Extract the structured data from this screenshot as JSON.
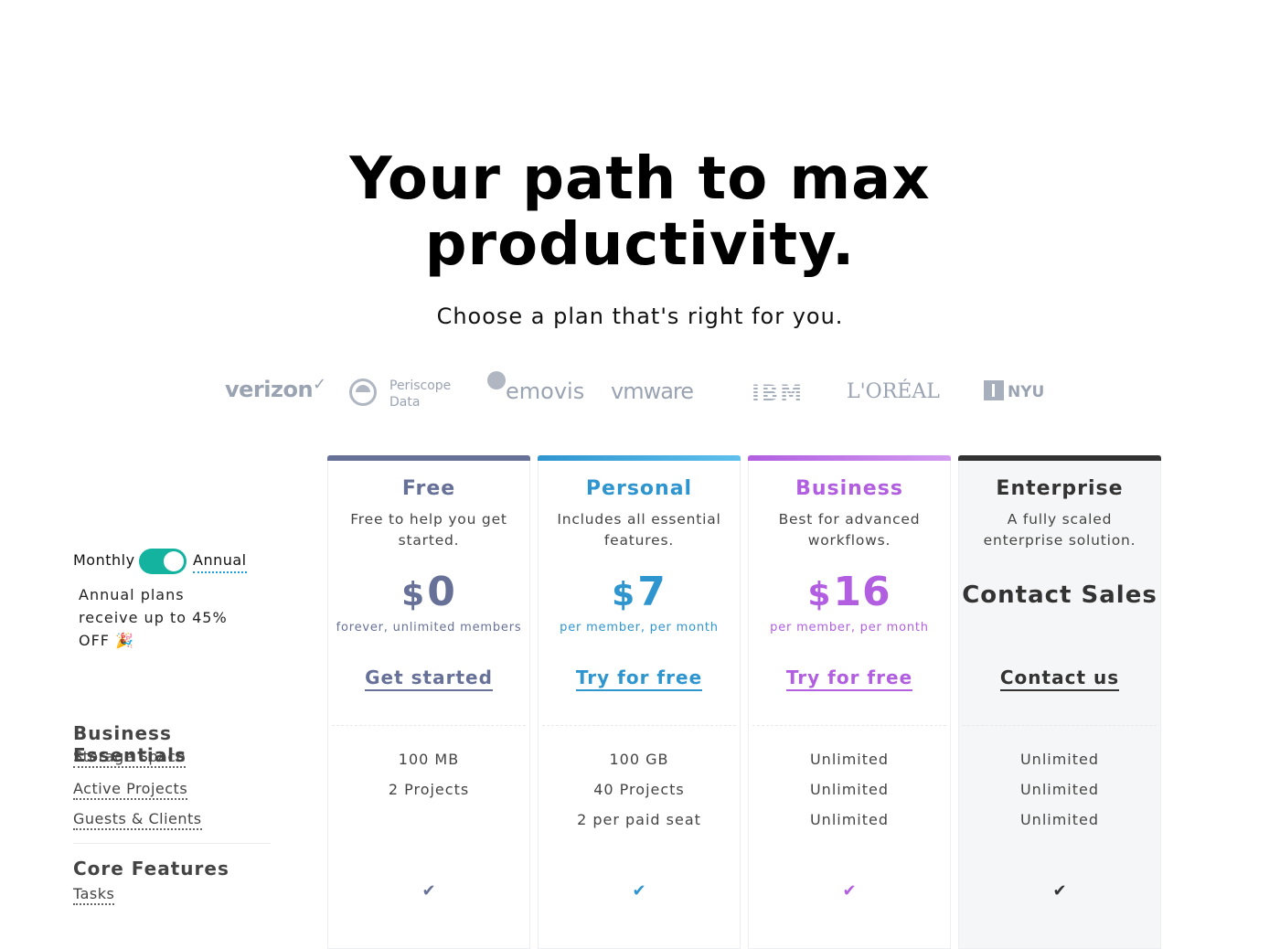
{
  "hero": {
    "title_line1": "Your path to max",
    "title_line2": "productivity.",
    "subtitle": "Choose a plan that's right for you."
  },
  "logos": {
    "verizon": "verizon",
    "verizon_mark": "✓",
    "periscope_1": "Periscope",
    "periscope_2": "Data",
    "emovis": "emovis",
    "vmware": "vmware",
    "ibm": "IBM",
    "loreal": "L'ORÉAL",
    "nyu": "NYU"
  },
  "billing": {
    "monthly_label": "Monthly",
    "annual_label": "Annual",
    "toggle_state": "annual",
    "promo": "Annual plans receive up to 45% OFF 🎉"
  },
  "sections": {
    "business_essentials": "Business Essentials",
    "features_be": [
      "Storage Space",
      "Active Projects",
      "Guests & Clients"
    ],
    "core_features": "Core Features",
    "features_cf": [
      "Tasks"
    ]
  },
  "plans": [
    {
      "name": "Free",
      "desc": "Free to help you get started.",
      "currency": "$",
      "amount": "0",
      "per": "forever, unlimited members",
      "cta": "Get started",
      "cells": [
        "100 MB",
        "2 Projects",
        ""
      ],
      "check": "✔"
    },
    {
      "name": "Personal",
      "desc": "Includes all essential features.",
      "currency": "$",
      "amount": "7",
      "per": "per member, per month",
      "cta": "Try for free",
      "cells": [
        "100 GB",
        "40 Projects",
        "2 per paid seat"
      ],
      "check": "✔"
    },
    {
      "name": "Business",
      "desc": "Best for advanced workflows.",
      "currency": "$",
      "amount": "16",
      "per": "per member, per month",
      "cta": "Try for free",
      "cells": [
        "Unlimited",
        "Unlimited",
        "Unlimited"
      ],
      "check": "✔"
    },
    {
      "name": "Enterprise",
      "desc": "A fully scaled enterprise solution.",
      "contact_sales": "Contact Sales",
      "cta": "Contact us",
      "cells": [
        "Unlimited",
        "Unlimited",
        "Unlimited"
      ],
      "check": "✔"
    }
  ],
  "colors": {
    "free": "#677198",
    "personal": "#2f95cf",
    "business": "#b15fe0",
    "enterprise": "#333333",
    "toggle": "#14b3a0"
  }
}
